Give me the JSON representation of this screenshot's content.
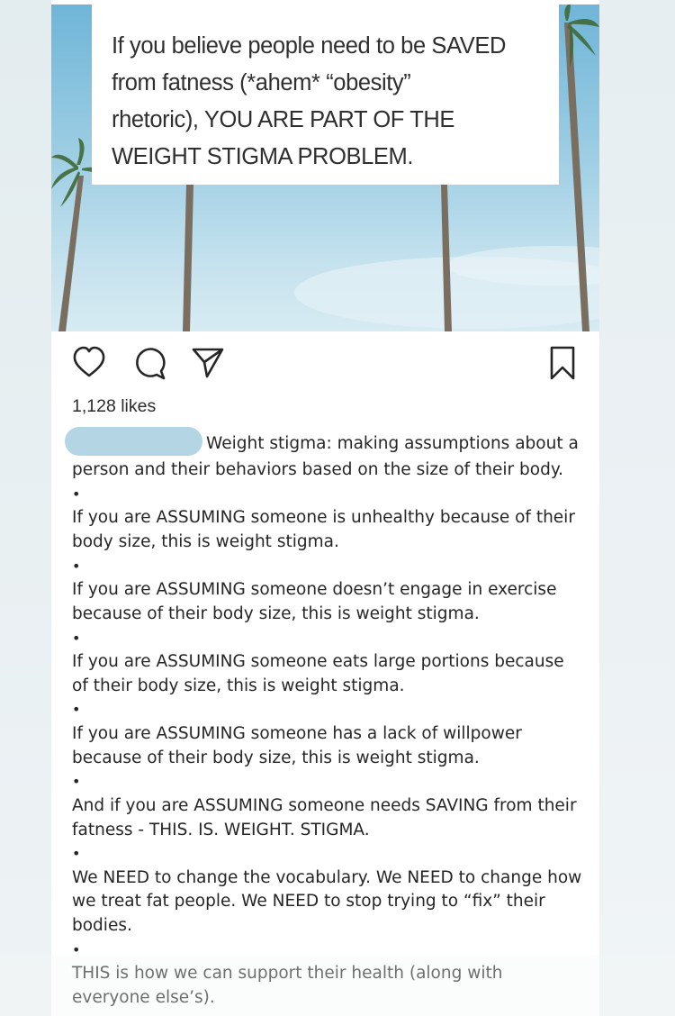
{
  "quote": {
    "lines": [
      "If you believe people need to be SAVED",
      "from fatness (*ahem* “obesity”",
      "rhetoric), YOU ARE PART OF THE",
      "WEIGHT STIGMA PROBLEM."
    ]
  },
  "actions": {
    "like_icon": "heart-icon",
    "comment_icon": "comment-icon",
    "share_icon": "send-icon",
    "save_icon": "bookmark-icon"
  },
  "likes": "1,128 likes",
  "caption": {
    "lead": "Weight stigma: making assumptions about a person and their behaviors based on the size of their body.",
    "bullet": "•",
    "paragraphs": [
      "If you are ASSUMING someone is unhealthy because of their body size, this is weight stigma.",
      "If you are ASSUMING someone doesn’t engage in exercise because of their body size, this is weight stigma.",
      "If you are ASSUMING someone eats large portions because of their body size, this is weight stigma.",
      "If you are ASSUMING someone has a lack of willpower because of their body size, this is weight stigma.",
      "And if you are ASSUMING someone needs SAVING from their fatness - THIS. IS. WEIGHT. STIGMA.",
      "We NEED to change the vocabulary. We NEED to change how we treat fat people. We NEED to stop trying to “fix” their bodies.",
      "THIS is how we can support their health (along with everyone else’s)."
    ]
  },
  "colors": {
    "sky": "#9ccde3",
    "redaction": "#b4d5e4",
    "text": "#262626"
  }
}
